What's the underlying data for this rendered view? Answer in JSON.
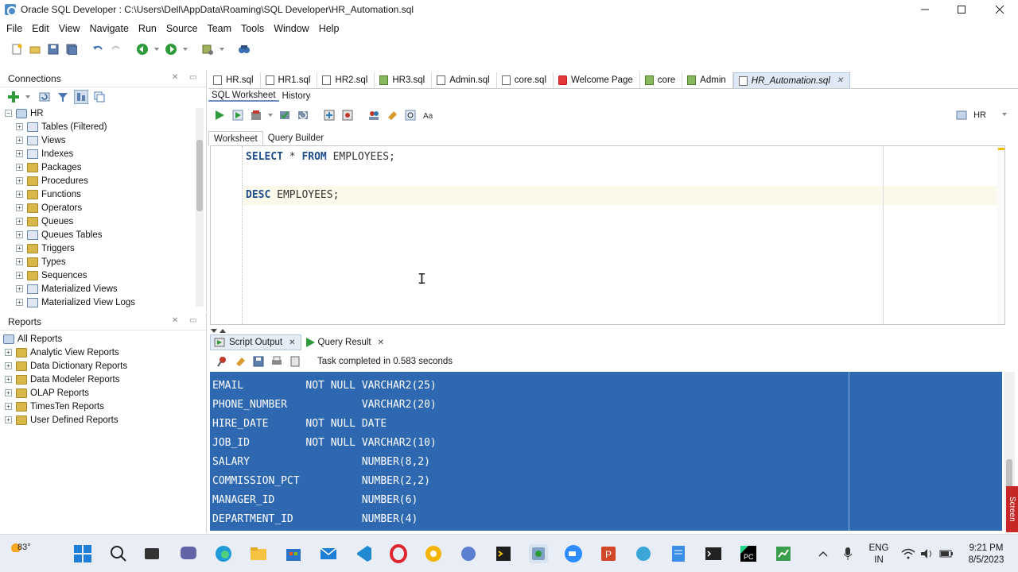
{
  "window": {
    "title": "Oracle SQL Developer : C:\\Users\\Dell\\AppData\\Roaming\\SQL Developer\\HR_Automation.sql",
    "minimize_icon": "minimize-icon",
    "maximize_icon": "maximize-icon",
    "close_icon": "close-icon"
  },
  "menu": {
    "file": "File",
    "edit": "Edit",
    "view": "View",
    "navigate": "Navigate",
    "run": "Run",
    "source": "Source",
    "team": "Team",
    "tools": "Tools",
    "window": "Window",
    "help": "Help"
  },
  "connections_panel": {
    "title": "Connections",
    "root": "HR",
    "items": [
      {
        "label": "Tables (Filtered)"
      },
      {
        "label": "Views"
      },
      {
        "label": "Indexes"
      },
      {
        "label": "Packages"
      },
      {
        "label": "Procedures"
      },
      {
        "label": "Functions"
      },
      {
        "label": "Operators"
      },
      {
        "label": "Queues"
      },
      {
        "label": "Queues Tables"
      },
      {
        "label": "Triggers"
      },
      {
        "label": "Types"
      },
      {
        "label": "Sequences"
      },
      {
        "label": "Materialized Views"
      },
      {
        "label": "Materialized View Logs"
      }
    ]
  },
  "reports_panel": {
    "title": "Reports",
    "root": "All Reports",
    "items": [
      {
        "label": "Analytic View Reports"
      },
      {
        "label": "Data Dictionary Reports"
      },
      {
        "label": "Data Modeler Reports"
      },
      {
        "label": "OLAP Reports"
      },
      {
        "label": "TimesTen Reports"
      },
      {
        "label": "User Defined Reports"
      }
    ]
  },
  "doc_tabs": [
    {
      "label": "HR.sql"
    },
    {
      "label": "HR1.sql"
    },
    {
      "label": "HR2.sql"
    },
    {
      "label": "HR3.sql"
    },
    {
      "label": "Admin.sql"
    },
    {
      "label": "core.sql"
    },
    {
      "label": "Welcome Page"
    },
    {
      "label": "core"
    },
    {
      "label": "Admin"
    },
    {
      "label": "HR_Automation.sql"
    }
  ],
  "worksheet_subtabs": {
    "sql_worksheet": "SQL Worksheet",
    "history": "History"
  },
  "connection_selector": {
    "value": "HR"
  },
  "workbench_tabs": {
    "worksheet": "Worksheet",
    "query_builder": "Query Builder"
  },
  "editor": {
    "line1_kw1": "SELECT",
    "line1_rest": " * ",
    "line1_kw2": "FROM",
    "line1_tail": " EMPLOYEES;",
    "line2_kw": "DESC",
    "line2_tail": " EMPLOYEES;"
  },
  "output_tabs": {
    "script_output": "Script Output",
    "query_result": "Query Result"
  },
  "output_status": "Task completed in 0.583 seconds",
  "output_lines": [
    "EMAIL          NOT NULL VARCHAR2(25)",
    "PHONE_NUMBER            VARCHAR2(20)",
    "HIRE_DATE      NOT NULL DATE",
    "JOB_ID         NOT NULL VARCHAR2(10)",
    "SALARY                  NUMBER(8,2)",
    "COMMISSION_PCT          NUMBER(2,2)",
    "MANAGER_ID              NUMBER(6)",
    "DEPARTMENT_ID           NUMBER(4)"
  ],
  "taskbar": {
    "weather": "83°",
    "language_top": "ENG",
    "language_bottom": "IN",
    "time": "9:21 PM",
    "date": "8/5/2023",
    "screen_tag": "Screen"
  }
}
